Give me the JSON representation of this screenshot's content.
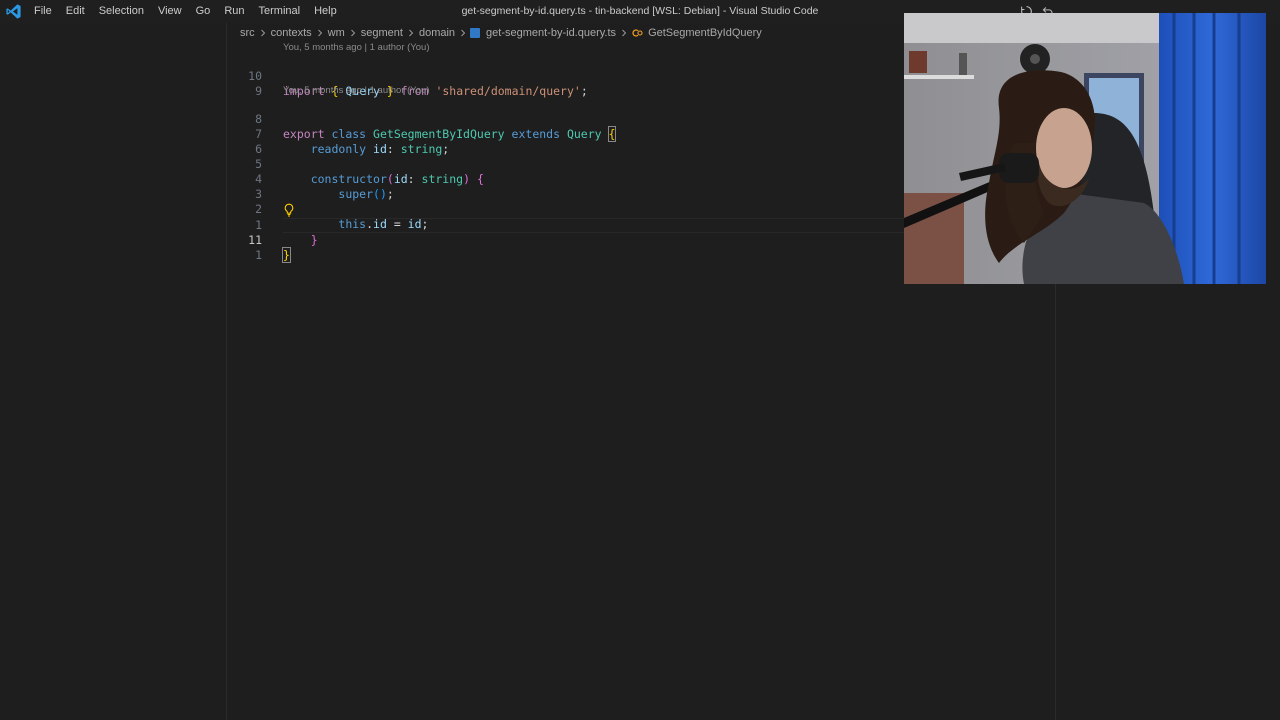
{
  "titlebar": {
    "menu": [
      "File",
      "Edit",
      "Selection",
      "View",
      "Go",
      "Run",
      "Terminal",
      "Help"
    ],
    "window_title": "get-segment-by-id.query.ts - tin-backend [WSL: Debian] - Visual Studio Code"
  },
  "breadcrumb": {
    "parts": [
      "src",
      "contexts",
      "wm",
      "segment",
      "domain"
    ],
    "file": "get-segment-by-id.query.ts",
    "symbol": "GetSegmentByIdQuery"
  },
  "blame": {
    "import": "You, 5 months ago | 1 author (You)",
    "class": "You, 5 months ago | 1 author (You)"
  },
  "editor": {
    "lines": [
      {
        "num": "10",
        "active": false
      },
      {
        "num": "9",
        "active": false
      },
      {
        "num": "8",
        "active": false
      },
      {
        "num": "7",
        "active": false
      },
      {
        "num": "6",
        "active": false
      },
      {
        "num": "5",
        "active": false
      },
      {
        "num": "4",
        "active": false
      },
      {
        "num": "3",
        "active": false
      },
      {
        "num": "2",
        "active": false
      },
      {
        "num": "1",
        "active": false
      },
      {
        "num": "11",
        "active": true
      },
      {
        "num": "1",
        "active": false
      }
    ],
    "code": {
      "import_kw": "import",
      "import_name": "Query",
      "from_kw": "from",
      "import_path": "'shared/domain/query'",
      "export_kw": "export",
      "class_kw": "class",
      "class_name": "GetSegmentByIdQuery",
      "extends_kw": "extends",
      "base_class": "Query",
      "readonly_kw": "readonly",
      "prop_name": "id",
      "prop_type": "string",
      "ctor_name": "constructor",
      "param_name": "id",
      "param_type": "string",
      "super_call": "super",
      "this_kw": "this",
      "assign_prop": "id",
      "assign_val": "id"
    }
  },
  "colors": {
    "accent": "#0078d4",
    "ts_icon": "#3178c6",
    "keyword": "#c586c0",
    "type": "#4ec9b0",
    "string": "#ce9178",
    "variable": "#9cdcfe",
    "function": "#dcdcaa"
  },
  "icons": {
    "logo": "vscode-logo-icon",
    "lightbulb": "lightbulb-icon",
    "chevron": "chevron-right-icon"
  }
}
